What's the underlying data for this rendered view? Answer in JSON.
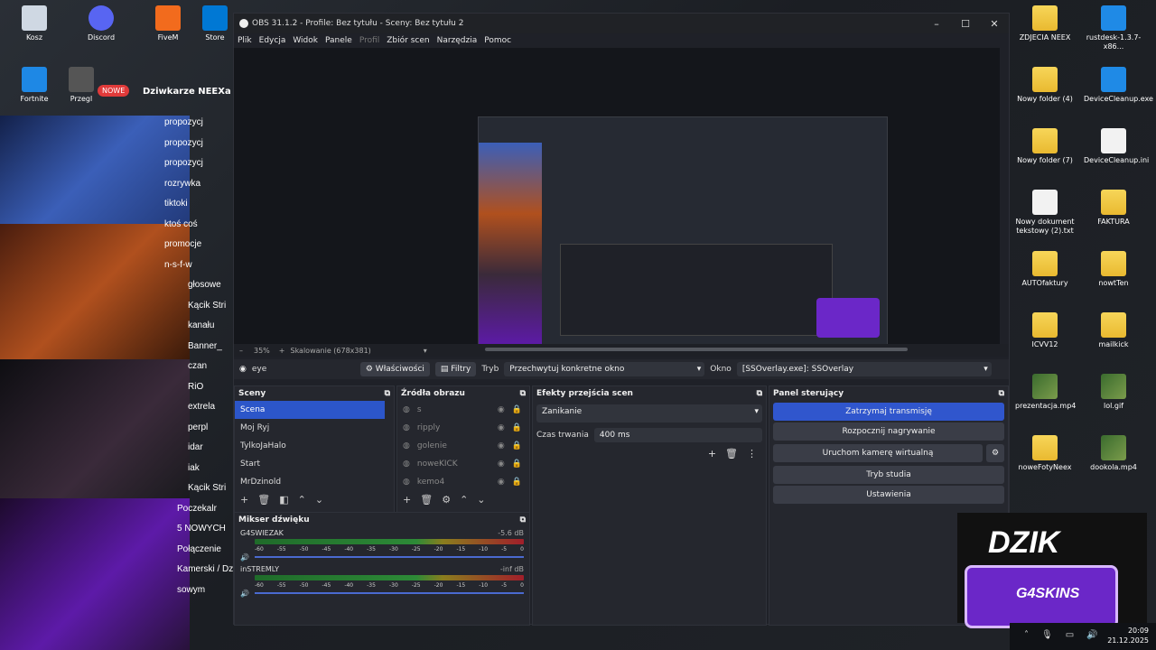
{
  "window_title": "OBS 31.1.2 - Profile: Bez tytułu - Sceny: Bez tytułu 2",
  "menu": [
    "Plik",
    "Edycja",
    "Widok",
    "Panele",
    "Profil",
    "Zbiór scen",
    "Narzędzia",
    "Pomoc"
  ],
  "zoom": {
    "percent": "35%",
    "scaling": "Skalowanie (678x381)"
  },
  "source_bar": {
    "source_name": "eye",
    "properties": "Właściwości",
    "filters": "Filtry",
    "mode_label": "Tryb",
    "mode_value": "Przechwytuj konkretne okno",
    "window_label": "Okno",
    "window_value": "[SSOverlay.exe]: SSOverlay"
  },
  "scenes": {
    "title": "Sceny",
    "items": [
      "Scena",
      "Moj Ryj",
      "TylkoJaHalo",
      "Start",
      "MrDzinold"
    ]
  },
  "sources": {
    "title": "Źródła obrazu",
    "items": [
      "s",
      "ripply",
      "golenie",
      "noweKICK",
      "kemo4"
    ]
  },
  "transitions": {
    "title": "Efekty przejścia scen",
    "effect": "Zanikanie",
    "duration_label": "Czas trwania",
    "duration_value": "400 ms"
  },
  "controls": {
    "title": "Panel sterujący",
    "buttons": [
      "Zatrzymaj transmisję",
      "Rozpocznij nagrywanie",
      "Uruchom kamerę wirtualną",
      "Tryb studia",
      "Ustawienia"
    ]
  },
  "mixer": {
    "title": "Mikser dźwięku",
    "channels": [
      {
        "name": "G4SWIEZAK",
        "db": "-5.6 dB"
      },
      {
        "name": "inSTREMLY",
        "db": "-inf dB"
      }
    ],
    "scale": [
      "-60",
      "-55",
      "-50",
      "-45",
      "-40",
      "-35",
      "-30",
      "-25",
      "-20",
      "-15",
      "-10",
      "-5",
      "0"
    ]
  },
  "desktop_left": [
    "Kosz",
    "Discord",
    "FiveM",
    "Store",
    "Fortnite",
    "Przegl"
  ],
  "desktop_right": [
    {
      "label": "ZDJECIA NEEX",
      "type": "folder"
    },
    {
      "label": "rustdesk-1.3.7-x86...",
      "type": "app"
    },
    {
      "label": "Nowy folder (4)",
      "type": "folder"
    },
    {
      "label": "DeviceCleanup.exe",
      "type": "app"
    },
    {
      "label": "Nowy folder (7)",
      "type": "folder"
    },
    {
      "label": "DeviceCleanup.ini",
      "type": "file"
    },
    {
      "label": "Nowy dokument tekstowy (2).txt",
      "type": "file"
    },
    {
      "label": "FAKTURA",
      "type": "folder"
    },
    {
      "label": "AUTOfaktury",
      "type": "folder"
    },
    {
      "label": "nowtTen",
      "type": "folder"
    },
    {
      "label": "ICVV12",
      "type": "folder"
    },
    {
      "label": "mailkick",
      "type": "folder"
    },
    {
      "label": "prezentacja.mp4",
      "type": "image"
    },
    {
      "label": "lol.gif",
      "type": "image"
    },
    {
      "label": "noweFotyNeex",
      "type": "folder"
    },
    {
      "label": "dookola.mp4",
      "type": "image"
    }
  ],
  "chat": {
    "badge": "NOWE",
    "title": "Dziwkarze NEEXa",
    "items": [
      "propozycj",
      "propozycj",
      "propozycj",
      "rozrywka",
      "tiktoki",
      "ktoś coś",
      "promocje",
      "n-s-f-w",
      "głosowe",
      "Kącik Stri",
      "kanału",
      "Banner_",
      "czan",
      "RiO",
      "extrela",
      "perpl",
      "idar",
      "iak",
      "Kącik Stri",
      "Poczekalr",
      "5 NOWYCH",
      "Połączenie",
      "Kamerski / Dziwkar",
      "sowym"
    ]
  },
  "logo": {
    "brand": "DZIK",
    "sub": "G4SKINS"
  },
  "clock": {
    "time": "20:09",
    "date": "21.12.2025"
  },
  "colors": {
    "accent": "#2c56c9",
    "panel": "#25272e",
    "bg": "#1f2128"
  }
}
